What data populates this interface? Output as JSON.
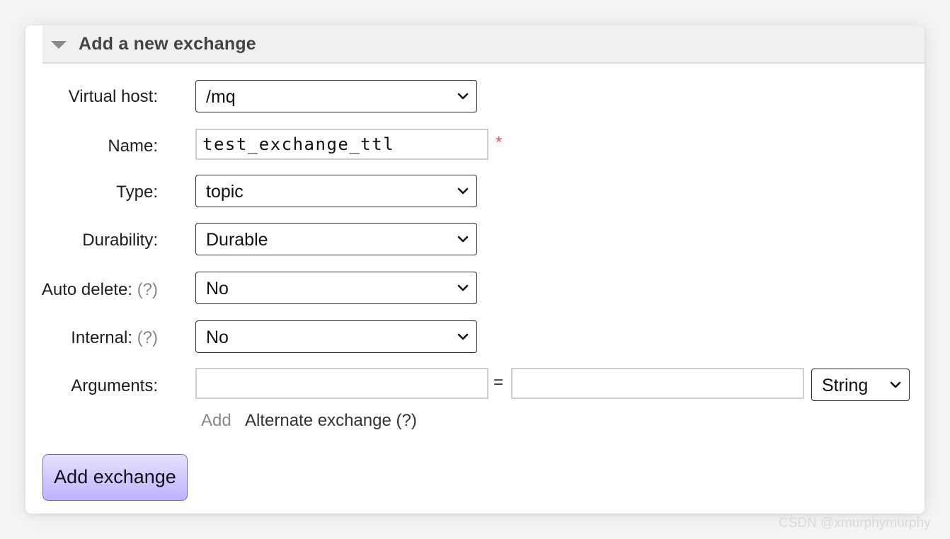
{
  "section": {
    "title": "Add a new exchange"
  },
  "form": {
    "virtual_host": {
      "label": "Virtual host:",
      "value": "/mq"
    },
    "name": {
      "label": "Name:",
      "value": "test_exchange_ttl",
      "required_mark": "*"
    },
    "type": {
      "label": "Type:",
      "value": "topic"
    },
    "durability": {
      "label": "Durability:",
      "value": "Durable"
    },
    "auto_delete": {
      "label": "Auto delete:",
      "help": "(?)",
      "value": "No"
    },
    "internal": {
      "label": "Internal:",
      "help": "(?)",
      "value": "No"
    },
    "arguments": {
      "label": "Arguments:",
      "key_value": "",
      "equals": "=",
      "value_value": "",
      "type_value": "String",
      "add_link": "Add",
      "alternate_link": "Alternate exchange (?)"
    }
  },
  "submit": {
    "label": "Add exchange"
  },
  "watermark": "CSDN @xmurphymurphy",
  "colors": {
    "required": "#e05a5a",
    "button_top": "#e6e1ff",
    "button_bottom": "#bdb3ff",
    "button_border": "#6b6bd6"
  }
}
